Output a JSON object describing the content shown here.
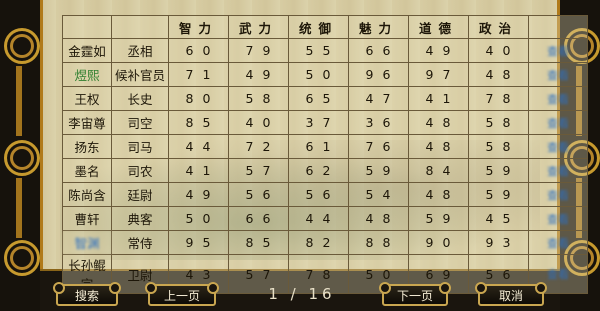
{
  "table": {
    "headers": [
      "",
      "",
      "智力",
      "武力",
      "统御",
      "魅力",
      "道德",
      "政治",
      ""
    ],
    "rows": [
      {
        "name": "金霆如",
        "office": "丞相",
        "stats": [
          "60",
          "79",
          "55",
          "66",
          "49",
          "40"
        ],
        "action": "查看",
        "name_style": "normal",
        "action_blur": true
      },
      {
        "name": "煜熙",
        "office": "候补官员",
        "stats": [
          "71",
          "49",
          "50",
          "96",
          "97",
          "48"
        ],
        "action": "查看",
        "name_style": "green",
        "action_blur": true
      },
      {
        "name": "王权",
        "office": "长史",
        "stats": [
          "80",
          "58",
          "65",
          "47",
          "41",
          "78"
        ],
        "action": "查看",
        "name_style": "normal",
        "action_blur": true
      },
      {
        "name": "李宙尊",
        "office": "司空",
        "stats": [
          "85",
          "40",
          "37",
          "36",
          "48",
          "58"
        ],
        "action": "查看",
        "name_style": "normal",
        "action_blur": true
      },
      {
        "name": "扬东",
        "office": "司马",
        "stats": [
          "44",
          "72",
          "61",
          "76",
          "48",
          "58"
        ],
        "action": "查看",
        "name_style": "normal",
        "action_blur": true
      },
      {
        "name": "墨名",
        "office": "司农",
        "stats": [
          "41",
          "57",
          "62",
          "59",
          "84",
          "59"
        ],
        "action": "查看",
        "name_style": "normal",
        "action_blur": true
      },
      {
        "name": "陈尚含",
        "office": "廷尉",
        "stats": [
          "49",
          "56",
          "56",
          "54",
          "48",
          "59"
        ],
        "action": "查看",
        "name_style": "normal",
        "action_blur": true
      },
      {
        "name": "曹轩",
        "office": "典客",
        "stats": [
          "50",
          "66",
          "44",
          "48",
          "59",
          "45"
        ],
        "action": "查看",
        "name_style": "normal",
        "action_blur": true
      },
      {
        "name": "智渊",
        "office": "常侍",
        "stats": [
          "95",
          "85",
          "82",
          "88",
          "90",
          "93"
        ],
        "action": "查看",
        "name_style": "blue-blur",
        "action_blur": true
      },
      {
        "name": "长孙鲲宗",
        "office": "卫尉",
        "stats": [
          "43",
          "57",
          "78",
          "50",
          "69",
          "56"
        ],
        "action": "查看",
        "name_style": "normal",
        "action_blur": true
      }
    ]
  },
  "buttons": {
    "search": "搜索",
    "prev": "上一页",
    "next": "下一页",
    "cancel": "取消"
  },
  "pager": {
    "text": "1 / 16"
  },
  "colors": {
    "frame": "#16120c",
    "gold": "#c9a650",
    "link": "#2d6fbf"
  }
}
